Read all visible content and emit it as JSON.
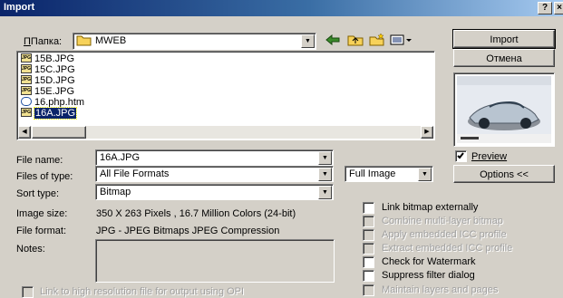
{
  "window": {
    "title": "Import",
    "help_label": "?",
    "close_label": "×"
  },
  "lookin": {
    "label": "Папка:",
    "folder": "MWEB"
  },
  "toolbar": {
    "back_icon": "back-arrow-icon",
    "up_icon": "up-folder-icon",
    "new_folder_icon": "new-folder-icon",
    "view_icon": "view-menu-icon"
  },
  "files": [
    {
      "name": "15B.JPG",
      "type": "jpg"
    },
    {
      "name": "15C.JPG",
      "type": "jpg"
    },
    {
      "name": "15D.JPG",
      "type": "jpg"
    },
    {
      "name": "15E.JPG",
      "type": "jpg"
    },
    {
      "name": "16.php.htm",
      "type": "htm"
    },
    {
      "name": "16A.JPG",
      "type": "jpg",
      "selected": true
    }
  ],
  "icon_text": "JPG",
  "buttons": {
    "import": "Import",
    "cancel": "Отмена",
    "options": "Options <<"
  },
  "preview": {
    "label": "Preview",
    "checked": true
  },
  "form": {
    "filename_label": "File name:",
    "filename_value": "16A.JPG",
    "filetype_label": "Files of type:",
    "filetype_value": "All File Formats",
    "sort_label": "Sort type:",
    "sort_value": "Bitmap",
    "mode_value": "Full Image"
  },
  "info": {
    "size_label": "Image size:",
    "size_value": "350 X 263 Pixels , 16.7 Million Colors (24-bit)",
    "format_label": "File format:",
    "format_value": "JPG - JPEG Bitmaps JPEG Compression",
    "notes_label": "Notes:"
  },
  "options": [
    {
      "label": "Link bitmap externally",
      "enabled": true
    },
    {
      "label": "Combine multi-layer bitmap",
      "enabled": false
    },
    {
      "label": "Apply embedded ICC profile",
      "enabled": false
    },
    {
      "label": "Extract embedded ICC profile",
      "enabled": false
    },
    {
      "label": "Check for Watermark",
      "enabled": true
    },
    {
      "label": "Suppress filter dialog",
      "enabled": true
    },
    {
      "label": "Maintain layers and pages",
      "enabled": false
    }
  ],
  "link_high_res": {
    "label": "Link to high resolution file for output using OPI",
    "enabled": false
  }
}
